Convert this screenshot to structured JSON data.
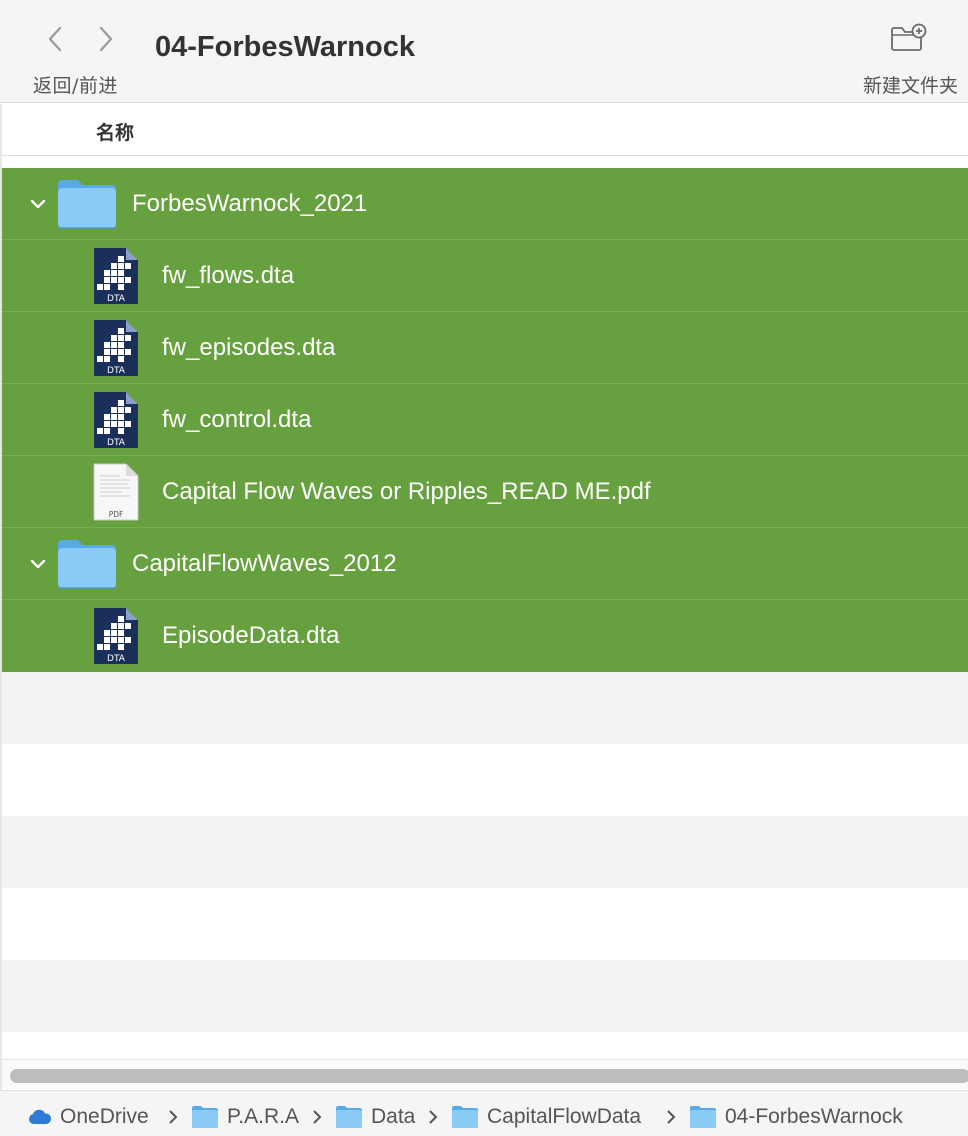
{
  "window": {
    "title": "04-ForbesWarnock",
    "nav_caption": "返回/前进",
    "new_folder_caption": "新建文件夹"
  },
  "columns": {
    "name": "名称"
  },
  "files": [
    {
      "name": "ForbesWarnock_2021",
      "kind": "folder",
      "expanded": true,
      "level": 0
    },
    {
      "name": "fw_flows.dta",
      "kind": "dta",
      "badge": "DTA",
      "level": 1
    },
    {
      "name": "fw_episodes.dta",
      "kind": "dta",
      "badge": "DTA",
      "level": 1
    },
    {
      "name": "fw_control.dta",
      "kind": "dta",
      "badge": "DTA",
      "level": 1
    },
    {
      "name": "Capital Flow Waves or Ripples_READ ME.pdf",
      "kind": "pdf",
      "badge": "PDF",
      "level": 1
    },
    {
      "name": "CapitalFlowWaves_2012",
      "kind": "folder",
      "expanded": true,
      "level": 0
    },
    {
      "name": "EpisodeData.dta",
      "kind": "dta",
      "badge": "DTA",
      "level": 1
    }
  ],
  "pathbar": [
    "OneDrive",
    "P.A.R.A",
    "Data",
    "CapitalFlowData",
    "04-ForbesWarnock"
  ],
  "colors": {
    "selection": "#66a03f",
    "folder": "#7cc1f4",
    "dta_icon": "#1a2f5a",
    "onedrive": "#2f7ad6"
  },
  "icons": {
    "back": "chevron-left-icon",
    "forward": "chevron-right-icon",
    "new_folder": "folder-plus-icon",
    "disclosure": "chevron-down-icon",
    "folder": "folder-icon",
    "dta": "dta-file-icon",
    "pdf": "pdf-file-icon",
    "cloud": "onedrive-cloud-icon"
  }
}
